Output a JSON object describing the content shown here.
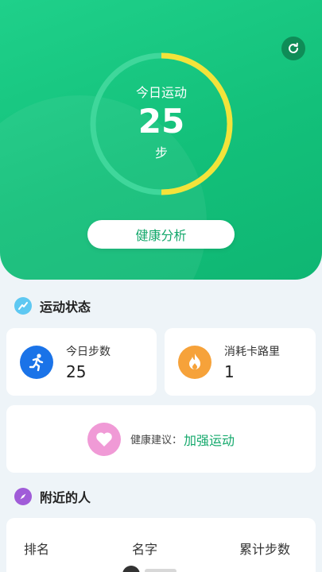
{
  "hero": {
    "ring_label": "今日运动",
    "ring_value": "25",
    "ring_unit": "步",
    "ring_progress": 0.5,
    "analysis_button": "健康分析"
  },
  "motion_status": {
    "title": "运动状态",
    "steps_label": "今日步数",
    "steps_value": "25",
    "calories_label": "消耗卡路里",
    "calories_value": "1"
  },
  "advice": {
    "label": "健康建议：",
    "value": "加强运动"
  },
  "nearby": {
    "title": "附近的人",
    "columns": [
      "排名",
      "名字",
      "累计步数"
    ]
  },
  "colors": {
    "accent": "#13c07a",
    "ring_track": "#3fd79b",
    "ring_progress": "#f3e33a",
    "advice_text": "#13a86b"
  },
  "icons": {
    "refresh": "refresh-icon",
    "status": "trend-icon",
    "steps": "running-person-icon",
    "calories": "flame-icon",
    "advice": "heart-icon",
    "nearby": "compass-icon"
  }
}
